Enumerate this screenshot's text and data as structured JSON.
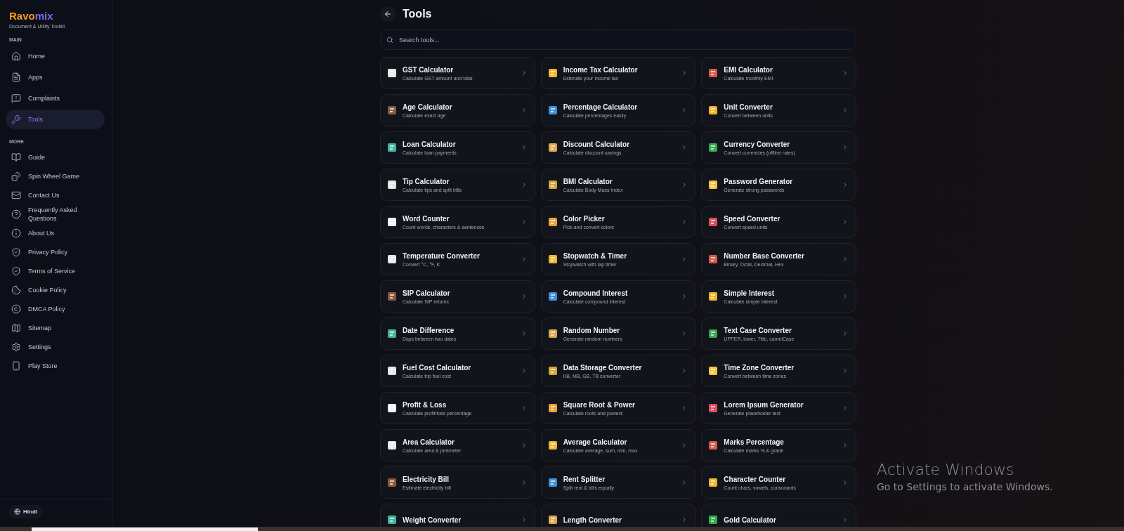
{
  "brand": {
    "name_part_1": "Ravo",
    "name_part_2": "mix",
    "tagline": "Document & Utility Toolkit"
  },
  "sidebar": {
    "sections": [
      {
        "label": "MAIN",
        "items": [
          {
            "label": "Home",
            "selected": false
          },
          {
            "label": "Apps",
            "selected": false
          },
          {
            "label": "Complaints",
            "selected": false
          },
          {
            "label": "Tools",
            "selected": true
          }
        ]
      },
      {
        "label": "MORE",
        "items": [
          {
            "label": "Guide",
            "selected": false
          },
          {
            "label": "Spin Wheel Game",
            "selected": false
          },
          {
            "label": "Contact Us",
            "selected": false
          },
          {
            "label": "Frequently Asked Questions",
            "selected": false
          },
          {
            "label": "About Us",
            "selected": false
          },
          {
            "label": "Privacy Policy",
            "selected": false
          },
          {
            "label": "Terms of Service",
            "selected": false
          },
          {
            "label": "Cookie Policy",
            "selected": false
          },
          {
            "label": "DMCA Policy",
            "selected": false
          },
          {
            "label": "Sitemap",
            "selected": false
          },
          {
            "label": "Settings",
            "selected": false
          },
          {
            "label": "Play Store",
            "selected": false
          }
        ]
      }
    ],
    "language_button": "Hindi"
  },
  "page": {
    "title": "Tools",
    "search": {
      "placeholder": "Search tools..."
    }
  },
  "tools": [
    {
      "title": "GST Calculator",
      "description": "Calculate GST amount and total"
    },
    {
      "title": "Income Tax Calculator",
      "description": "Estimate your income tax"
    },
    {
      "title": "EMI Calculator",
      "description": "Calculate monthly EMI"
    },
    {
      "title": "Age Calculator",
      "description": "Calculate exact age"
    },
    {
      "title": "Percentage Calculator",
      "description": "Calculate percentages easily"
    },
    {
      "title": "Unit Converter",
      "description": "Convert between units"
    },
    {
      "title": "Loan Calculator",
      "description": "Calculate loan payments"
    },
    {
      "title": "Discount Calculator",
      "description": "Calculate discount savings"
    },
    {
      "title": "Currency Converter",
      "description": "Convert currencies (offline rates)"
    },
    {
      "title": "Tip Calculator",
      "description": "Calculate tips and split bills"
    },
    {
      "title": "BMI Calculator",
      "description": "Calculate Body Mass Index"
    },
    {
      "title": "Password Generator",
      "description": "Generate strong passwords"
    },
    {
      "title": "Word Counter",
      "description": "Count words, characters & sentences"
    },
    {
      "title": "Color Picker",
      "description": "Pick and convert colors"
    },
    {
      "title": "Speed Converter",
      "description": "Convert speed units"
    },
    {
      "title": "Temperature Converter",
      "description": "Convert °C, °F, K"
    },
    {
      "title": "Stopwatch & Timer",
      "description": "Stopwatch with lap timer"
    },
    {
      "title": "Number Base Converter",
      "description": "Binary, Octal, Decimal, Hex"
    },
    {
      "title": "SIP Calculator",
      "description": "Calculate SIP returns"
    },
    {
      "title": "Compound Interest",
      "description": "Calculate compound interest"
    },
    {
      "title": "Simple Interest",
      "description": "Calculate simple interest"
    },
    {
      "title": "Date Difference",
      "description": "Days between two dates"
    },
    {
      "title": "Random Number",
      "description": "Generate random numbers"
    },
    {
      "title": "Text Case Converter",
      "description": "UPPER, lower, Title, camelCase"
    },
    {
      "title": "Fuel Cost Calculator",
      "description": "Calculate trip fuel cost"
    },
    {
      "title": "Data Storage Converter",
      "description": "KB, MB, GB, TB converter"
    },
    {
      "title": "Time Zone Converter",
      "description": "Convert between time zones"
    },
    {
      "title": "Profit & Loss",
      "description": "Calculate profit/loss percentage"
    },
    {
      "title": "Square Root & Power",
      "description": "Calculate roots and powers"
    },
    {
      "title": "Lorem Ipsum Generator",
      "description": "Generate placeholder text"
    },
    {
      "title": "Area Calculator",
      "description": "Calculate area & perimeter"
    },
    {
      "title": "Average Calculator",
      "description": "Calculate average, sum, min, max"
    },
    {
      "title": "Marks Percentage",
      "description": "Calculate marks % & grade"
    },
    {
      "title": "Electricity Bill",
      "description": "Estimate electricity bill"
    },
    {
      "title": "Rent Splitter",
      "description": "Split rent & bills equally"
    },
    {
      "title": "Character Counter",
      "description": "Count chars, vowels, consonants"
    },
    {
      "title": "Weight Converter"
    },
    {
      "title": "Length Converter"
    },
    {
      "title": "Gold Calculator"
    }
  ],
  "os_notice": {
    "title": "Activate Windows",
    "message": "Go to Settings to activate Windows."
  }
}
